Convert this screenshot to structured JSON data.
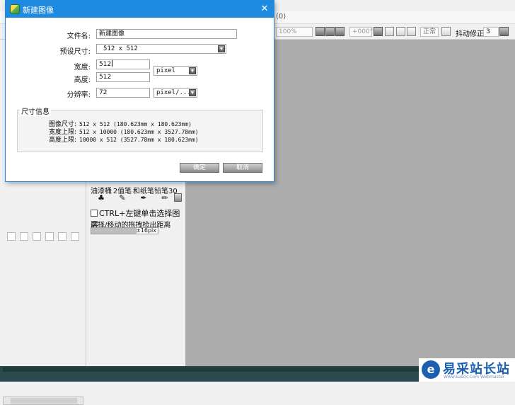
{
  "app": {
    "menu_tail": "(0)",
    "toolbar": {
      "zoom": "100%",
      "angle": "+000°",
      "mode": "正常",
      "stabilizer_label": "抖动修正",
      "stabilizer_value": "3"
    },
    "brushes": [
      {
        "name": "油漆桶",
        "icon": "bucket-icon",
        "glyph": "♣"
      },
      {
        "name": "2值笔",
        "icon": "pen-icon",
        "glyph": "✎"
      },
      {
        "name": "和纸笔",
        "icon": "brush-icon",
        "glyph": "✒"
      },
      {
        "name": "铅笔30",
        "icon": "pencil-icon",
        "glyph": "✏"
      }
    ],
    "ctrl_option": "CTRL+左键单击选择图层",
    "drag_label": "选择/移动的拖拽检出距离",
    "drag_value": "±16pix",
    "drag_fill_fraction": 0.68,
    "colors": {
      "accent": "#1e8be0",
      "canvas": "#acacac",
      "panel": "#f0f0f0"
    }
  },
  "dialog": {
    "title": "新建图像",
    "close_glyph": "✕",
    "filename_label": "文件名:",
    "filename_value": "新建图像",
    "preset_label": "预设尺寸:",
    "preset_value": "512 x  512",
    "width_label": "宽度:",
    "width_value": "512",
    "height_label": "高度:",
    "height_value": "512",
    "size_unit": "pixel",
    "resolution_label": "分辨率:",
    "resolution_value": "72",
    "resolution_unit": "pixel/...",
    "info_title": "尺寸信息",
    "info": [
      {
        "key": "图像尺寸:",
        "value": "512 x 512 (180.623mm x 180.623mm)"
      },
      {
        "key": "宽度上限:",
        "value": "512 x 10000 (180.623mm x 3527.78mm)"
      },
      {
        "key": "高度上限:",
        "value": "10000 x 512 (3527.78mm x 180.623mm)"
      }
    ],
    "ok_label": "确定",
    "cancel_label": "取消"
  },
  "watermark": {
    "logo_letter": "e",
    "title": "易采站长站",
    "subtitle": "Www.Easck.Com Webmaster"
  }
}
